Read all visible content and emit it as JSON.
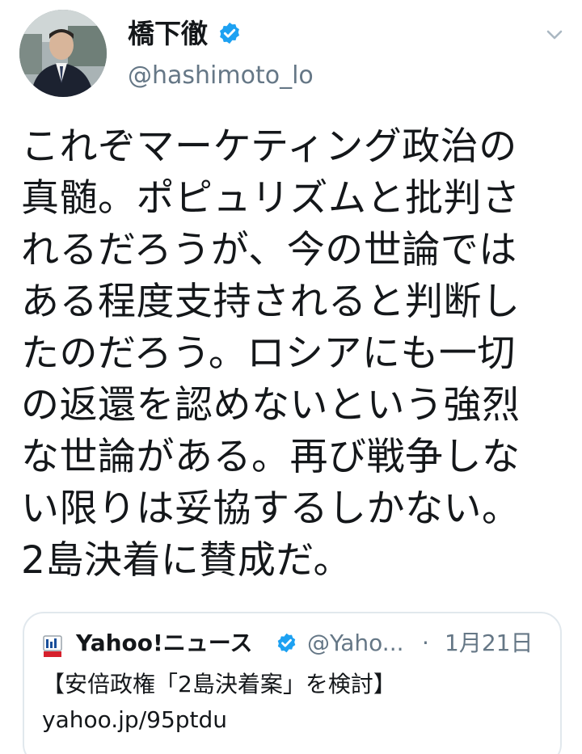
{
  "tweet": {
    "author": {
      "display_name": "橋下徹",
      "handle": "@hashimoto_lo",
      "verified": true,
      "avatar_icon": "profile-photo"
    },
    "menu_icon": "chevron-down-icon",
    "text_lines": [
      "これぞマーケティング政治の",
      "真髄。ポピュリズムと批判さ",
      "れるだろうが、今の世論では",
      "ある程度支持されると判断し",
      "たのだろう。ロシアにも一切",
      "の返還を認めないという強烈",
      "な世論がある。再び戦争しな",
      "い限りは妥協するしかない。",
      "2島決着に賛成だ。"
    ],
    "quoted": {
      "source_name": "Yahoo!ニュース",
      "verified": true,
      "handle": "@Yaho...",
      "separator": "·",
      "date": "1月21日",
      "text": "【安倍政権「2島決着案」を検討】",
      "link": "yahoo.jp/95ptdu"
    }
  },
  "colors": {
    "text_primary": "#14171a",
    "text_secondary": "#657786",
    "verified_blue": "#1da1f2",
    "card_border": "#e1e8ed"
  }
}
